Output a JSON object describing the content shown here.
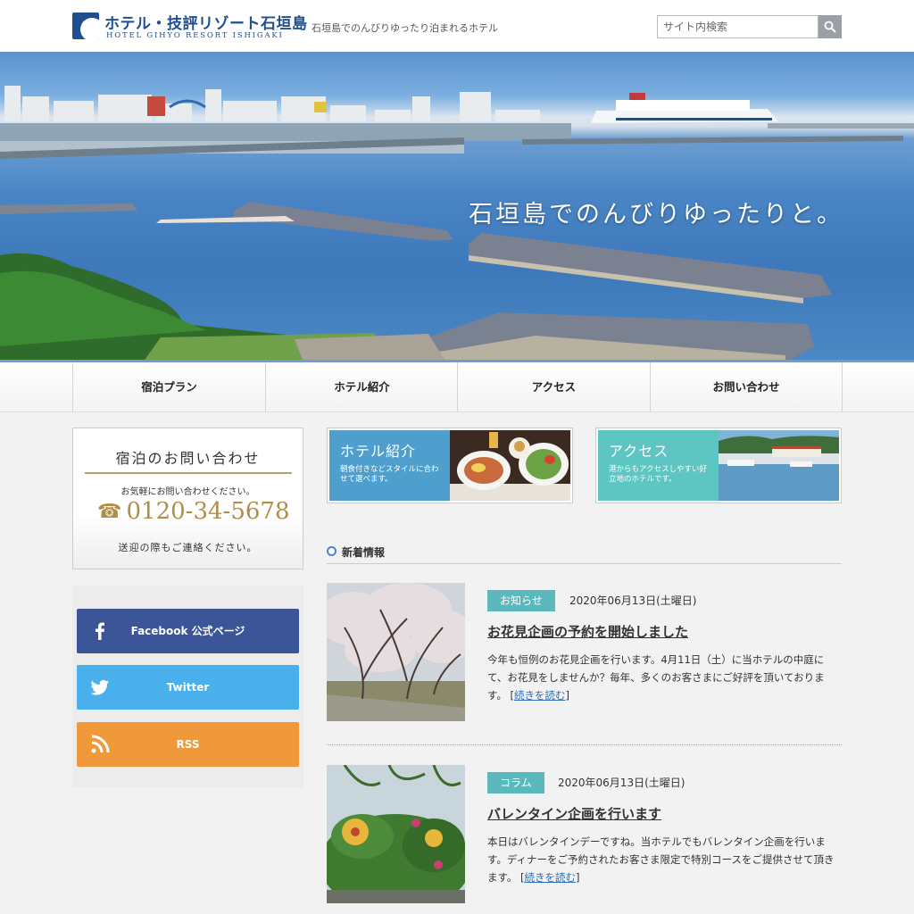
{
  "header": {
    "logo_jp": "ホテル・技評リゾート石垣島",
    "logo_en": "HOTEL GIHYO RESORT ISHIGAKI",
    "tagline": "石垣島でのんびりゆったり泊まれるホテル",
    "search_placeholder": "サイト内検索",
    "search_icon": "magnifier-icon"
  },
  "hero": {
    "caption": "石垣島でのんびりゆったりと。"
  },
  "nav": {
    "items": [
      "宿泊プラン",
      "ホテル紹介",
      "アクセス",
      "お問い合わせ"
    ]
  },
  "sidebar": {
    "contact": {
      "title": "宿泊のお問い合わせ",
      "note": "お気軽にお問い合わせください。",
      "phone_icon": "☎",
      "phone": "0120-34-5678",
      "note2": "送迎の際もご連絡ください。"
    },
    "social": [
      {
        "label": "Facebook 公式ページ",
        "icon": "facebook-icon",
        "color": "#3b5598"
      },
      {
        "label": "Twitter",
        "icon": "twitter-icon",
        "color": "#4ab0ec"
      },
      {
        "label": "RSS",
        "icon": "rss-icon",
        "color": "#f0993a"
      }
    ]
  },
  "banners": [
    {
      "title": "ホテル紹介",
      "sub": "朝食付きなどスタイルに合わせて選べます。",
      "color": "#4e9fce"
    },
    {
      "title": "アクセス",
      "sub": "港からもアクセスしやすい好立地のホテルです。",
      "color": "#5dc6c3"
    }
  ],
  "news": {
    "heading": "新着情報",
    "posts": [
      {
        "badge": "お知らせ",
        "date": "2020年06月13日(土曜日)",
        "title": "お花見企画の予約を開始しました",
        "body": "今年も恒例のお花見企画を行います。4月11日（土）に当ホテルの中庭にて、お花見をしませんか？毎年、多くのお客さまにご好評を頂いております。",
        "more": "続きを読む"
      },
      {
        "badge": "コラム",
        "date": "2020年06月13日(土曜日)",
        "title": "バレンタイン企画を行います",
        "body": "本日はバレンタインデーですね。当ホテルでもバレンタイン企画を行います。ディナーをご予約されたお客さま限定で特別コースをご提供させて頂きます。",
        "more": "続きを読む"
      }
    ]
  }
}
